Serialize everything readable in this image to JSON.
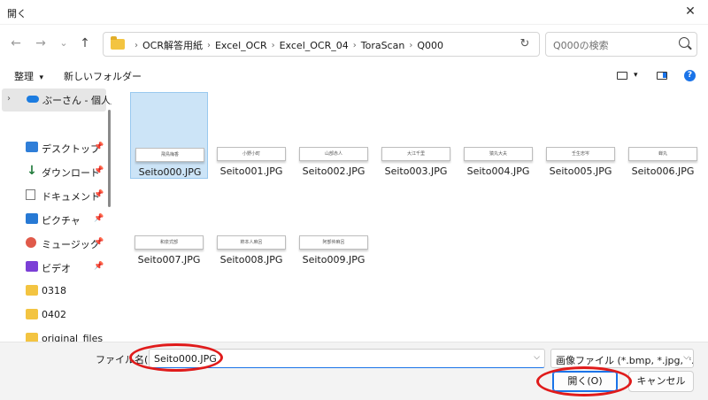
{
  "window": {
    "title": "開く",
    "close_glyph": "✕"
  },
  "nav": {
    "back": "←",
    "forward": "→",
    "recent": "⌄",
    "up": "↑"
  },
  "breadcrumb": {
    "separator": "›",
    "items": [
      "OCR解答用紙",
      "Excel_OCR",
      "Excel_OCR_04",
      "ToraScan",
      "Q000"
    ]
  },
  "search": {
    "placeholder": "Q000の検索"
  },
  "toolbar": {
    "organize_label": "整理",
    "organize_arrow": "▾",
    "new_folder_label": "新しいフォルダー",
    "view_arrow": "▾",
    "help_glyph": "?"
  },
  "sidebar": {
    "top": {
      "chevron": "›",
      "label": "ぶーさん - 個人用"
    },
    "pin_glyph": "📌",
    "items": [
      {
        "label": "デスクトップ",
        "pinned": true
      },
      {
        "label": "ダウンロード",
        "pinned": true
      },
      {
        "label": "ドキュメント",
        "pinned": true
      },
      {
        "label": "ピクチャ",
        "pinned": true
      },
      {
        "label": "ミュージック",
        "pinned": true
      },
      {
        "label": "ビデオ",
        "pinned": true
      },
      {
        "label": "0318",
        "pinned": false
      },
      {
        "label": "0402",
        "pinned": false
      },
      {
        "label": "original_files",
        "pinned": false
      }
    ]
  },
  "files": [
    {
      "name": "Seito000.JPG",
      "thumb_text": "飛鳥梅香",
      "selected": true
    },
    {
      "name": "Seito001.JPG",
      "thumb_text": "小野小町",
      "selected": false
    },
    {
      "name": "Seito002.JPG",
      "thumb_text": "山部赤人",
      "selected": false
    },
    {
      "name": "Seito003.JPG",
      "thumb_text": "大江千里",
      "selected": false
    },
    {
      "name": "Seito004.JPG",
      "thumb_text": "猿丸大夫",
      "selected": false
    },
    {
      "name": "Seito005.JPG",
      "thumb_text": "壬生忠岑",
      "selected": false
    },
    {
      "name": "Seito006.JPG",
      "thumb_text": "蝉丸",
      "selected": false
    },
    {
      "name": "Seito007.JPG",
      "thumb_text": "和泉式部",
      "selected": false
    },
    {
      "name": "Seito008.JPG",
      "thumb_text": "柿本人麻呂",
      "selected": false
    },
    {
      "name": "Seito009.JPG",
      "thumb_text": "阿部仲麻呂",
      "selected": false
    }
  ],
  "bottom": {
    "filename_label": "ファイル名(N):",
    "filename_value": "Seito000.JPG",
    "dropdown_glyph": "⌵",
    "filetype_value": "画像ファイル (*.bmp, *.jpg, *.jpeg",
    "open_label": "開く(O)",
    "cancel_label": "キャンセル"
  },
  "colors": {
    "accent": "#1a73e8",
    "selection": "#cce4f7",
    "annotation_red": "#e01b1b"
  }
}
